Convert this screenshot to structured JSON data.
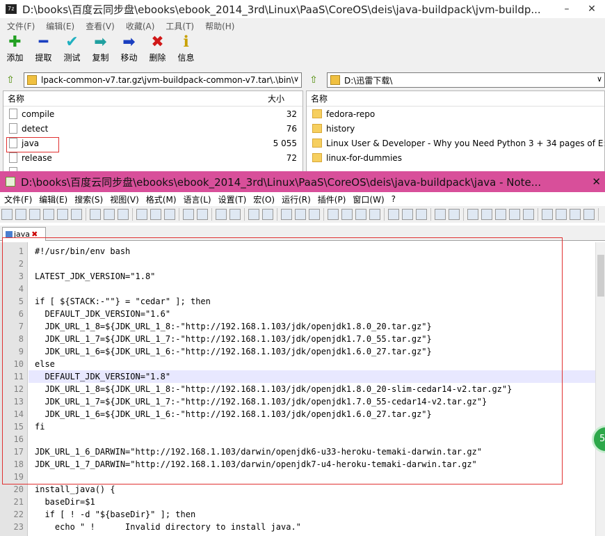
{
  "zip": {
    "title": "D:\\books\\百度云同步盘\\ebooks\\ebook_2014_3rd\\Linux\\PaaS\\CoreOS\\deis\\java-buildpack\\jvm-buildp...",
    "app_icon": "7z",
    "minimize": "–",
    "close": "✕",
    "menu": [
      "文件(F)",
      "编辑(E)",
      "查看(V)",
      "收藏(A)",
      "工具(T)",
      "帮助(H)"
    ],
    "toolbar": [
      {
        "label": "添加",
        "icon": "plus-icon",
        "glyph": "✚",
        "color": "#22a022"
      },
      {
        "label": "提取",
        "icon": "minus-icon",
        "glyph": "━",
        "color": "#1a3fc0"
      },
      {
        "label": "测试",
        "icon": "check-icon",
        "glyph": "✔",
        "color": "#20b0c0"
      },
      {
        "label": "复制",
        "icon": "copy-arrow-icon",
        "glyph": "➡",
        "color": "#20a0a0"
      },
      {
        "label": "移动",
        "icon": "move-arrow-icon",
        "glyph": "➡",
        "color": "#1a3fc0"
      },
      {
        "label": "删除",
        "icon": "delete-icon",
        "glyph": "✖",
        "color": "#d01818"
      },
      {
        "label": "信息",
        "icon": "info-icon",
        "glyph": "ℹ",
        "color": "#c8a000"
      }
    ],
    "left_path": "lpack-common-v7.tar.gz\\jvm-buildpack-common-v7.tar\\.\\bin\\",
    "right_path": "D:\\迅雷下载\\",
    "left_headers": {
      "name": "名称",
      "size": "大小"
    },
    "right_headers": {
      "name": "名称"
    },
    "left_files": [
      {
        "name": "compile",
        "size": "32"
      },
      {
        "name": "detect",
        "size": "76"
      },
      {
        "name": "java",
        "size": "5 055"
      },
      {
        "name": "release",
        "size": "72"
      },
      {
        "name": "...",
        "size": "..."
      }
    ],
    "right_items": [
      {
        "name": "fedora-repo"
      },
      {
        "name": "history"
      },
      {
        "name": "Linux User & Developer - Why you Need Python 3 + 34 pages of E:"
      },
      {
        "name": "linux-for-dummies"
      }
    ]
  },
  "npp": {
    "title": "D:\\books\\百度云同步盘\\ebooks\\ebook_2014_3rd\\Linux\\PaaS\\CoreOS\\deis\\java-buildpack\\java - Note...",
    "close": "✕",
    "menu": [
      "文件(F)",
      "编辑(E)",
      "搜索(S)",
      "视图(V)",
      "格式(M)",
      "语言(L)",
      "设置(T)",
      "宏(O)",
      "运行(R)",
      "插件(P)",
      "窗口(W)",
      "?"
    ],
    "tab_label": "java",
    "badge": "5",
    "lines": [
      "#!/usr/bin/env bash",
      "",
      "LATEST_JDK_VERSION=\"1.8\"",
      "",
      "if [ ${STACK:-\"\"} = \"cedar\" ]; then",
      "  DEFAULT_JDK_VERSION=\"1.6\"",
      "  JDK_URL_1_8=${JDK_URL_1_8:-\"http://192.168.1.103/jdk/openjdk1.8.0_20.tar.gz\"}",
      "  JDK_URL_1_7=${JDK_URL_1_7:-\"http://192.168.1.103/jdk/openjdk1.7.0_55.tar.gz\"}",
      "  JDK_URL_1_6=${JDK_URL_1_6:-\"http://192.168.1.103/jdk/openjdk1.6.0_27.tar.gz\"}",
      "else",
      "  DEFAULT_JDK_VERSION=\"1.8\"",
      "  JDK_URL_1_8=${JDK_URL_1_8:-\"http://192.168.1.103/jdk/openjdk1.8.0_20-slim-cedar14-v2.tar.gz\"}",
      "  JDK_URL_1_7=${JDK_URL_1_7:-\"http://192.168.1.103/jdk/openjdk1.7.0_55-cedar14-v2.tar.gz\"}",
      "  JDK_URL_1_6=${JDK_URL_1_6:-\"http://192.168.1.103/jdk/openjdk1.6.0_27.tar.gz\"}",
      "fi",
      "",
      "JDK_URL_1_6_DARWIN=\"http://192.168.1.103/darwin/openjdk6-u33-heroku-temaki-darwin.tar.gz\"",
      "JDK_URL_1_7_DARWIN=\"http://192.168.1.103/darwin/openjdk7-u4-heroku-temaki-darwin.tar.gz\"",
      "",
      "install_java() {",
      "  baseDir=$1",
      "  if [ ! -d \"${baseDir}\" ]; then",
      "    echo \" !      Invalid directory to install java.\""
    ],
    "line_numbers": [
      "1",
      "2",
      "3",
      "4",
      "5",
      "6",
      "7",
      "8",
      "9",
      "10",
      "11",
      "12",
      "13",
      "14",
      "15",
      "16",
      "17",
      "18",
      "19",
      "20",
      "21",
      "22",
      "23"
    ]
  }
}
